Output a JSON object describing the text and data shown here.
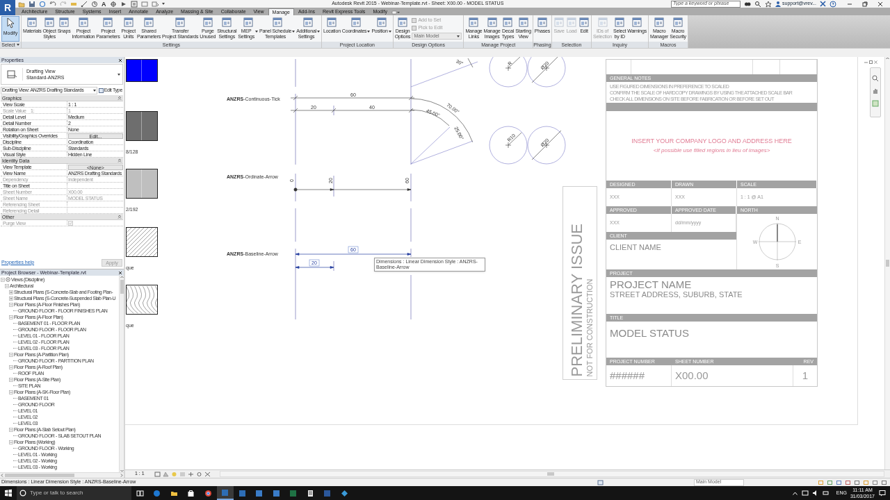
{
  "title_bar": {
    "app_button": "R",
    "text_tool": "A",
    "title": "Autodesk Revit 2015 -  Webinar-Template.rvt - Sheet: X00.00 - MODEL STATUS",
    "search_placeholder": "Type a keyword or phrase",
    "user": "support@vrev..."
  },
  "ribbon_tabs": [
    {
      "label": "Architecture",
      "selected": false
    },
    {
      "label": "Structure",
      "selected": false
    },
    {
      "label": "Systems",
      "selected": false
    },
    {
      "label": "Insert",
      "selected": false
    },
    {
      "label": "Annotate",
      "selected": false
    },
    {
      "label": "Analyze",
      "selected": false
    },
    {
      "label": "Massing & Site",
      "selected": false
    },
    {
      "label": "Collaborate",
      "selected": false
    },
    {
      "label": "View",
      "selected": false
    },
    {
      "label": "Manage",
      "selected": true
    },
    {
      "label": "Add-Ins",
      "selected": false
    },
    {
      "label": "Revit Express Tools",
      "selected": false
    },
    {
      "label": "Modify",
      "selected": false
    }
  ],
  "modify_tool": {
    "label": "Modify",
    "active": true,
    "panel_title": "Select"
  },
  "ribbon_panels": [
    {
      "title": "Settings",
      "tools": [
        {
          "label": "Materials"
        },
        {
          "label": "Object\nStyles"
        },
        {
          "label": "Snaps"
        },
        {
          "label": "Project\nInformation"
        },
        {
          "label": "Project\nParameters"
        },
        {
          "label": "Project\nUnits"
        },
        {
          "label": "Shared\nParameters"
        },
        {
          "label": "Transfer\nProject Standards"
        },
        {
          "label": "Purge\nUnused"
        },
        {
          "label": "Structural\nSettings"
        },
        {
          "label": "MEP\nSettings",
          "dropdown": true
        },
        {
          "label": "Panel Schedule\nTemplates",
          "dropdown": true
        },
        {
          "label": "Additional\nSettings",
          "dropdown": true
        }
      ]
    },
    {
      "title": "Project Location",
      "tools": [
        {
          "label": "Location"
        },
        {
          "label": "Coordinates",
          "dropdown": true
        },
        {
          "label": "Position",
          "dropdown": true
        }
      ]
    },
    {
      "title": "Design Options",
      "tools": [
        {
          "label": "Design\nOptions"
        }
      ],
      "small_tools": [
        {
          "label": "Add to Set",
          "disabled": true
        },
        {
          "label": "Pick to Edit",
          "disabled": true
        }
      ],
      "dropdown_value": "Main Model"
    },
    {
      "title": "Manage Project",
      "tools": [
        {
          "label": "Manage\nLinks"
        },
        {
          "label": "Manage\nImages"
        },
        {
          "label": "Decal\nTypes"
        },
        {
          "label": "Starting\nView"
        }
      ]
    },
    {
      "title": "Phasing",
      "tools": [
        {
          "label": "Phases"
        }
      ]
    },
    {
      "title": "Selection",
      "tools": [
        {
          "label": "Save",
          "disabled": true
        },
        {
          "label": "Load",
          "disabled": true
        },
        {
          "label": "Edit",
          "disabled": false
        }
      ]
    },
    {
      "title": "Inquiry",
      "tools": [
        {
          "label": "IDs of\nSelection",
          "disabled": true
        },
        {
          "label": "Select\nby ID",
          "disabled": false
        },
        {
          "label": "Warnings",
          "disabled": false
        }
      ]
    },
    {
      "title": "Macros",
      "tools": [
        {
          "label": "Macro\nManager"
        },
        {
          "label": "Macro\nSecurity"
        }
      ]
    }
  ],
  "properties": {
    "title": "Properties",
    "type_name": "Drafting View",
    "type_sub": "Standard-ANZRS",
    "instance_selector": "Drafting View: ANZRS Drafting Standards",
    "edit_type": "Edit Type",
    "groups": [
      {
        "title": "Graphics",
        "expanded": true,
        "rows": [
          {
            "name": "View Scale",
            "value": "1 : 1",
            "kind": "text",
            "disabled": false
          },
          {
            "name": "Scale Value    1:",
            "value": "1",
            "kind": "text",
            "disabled": true
          },
          {
            "name": "Detail Level",
            "value": "Medium",
            "kind": "text",
            "disabled": false
          },
          {
            "name": "Detail Number",
            "value": "2",
            "kind": "text",
            "disabled": false
          },
          {
            "name": "Rotation on Sheet",
            "value": "None",
            "kind": "text",
            "disabled": false
          },
          {
            "name": "Visibility/Graphics Overrides",
            "value": "Edit...",
            "kind": "button",
            "disabled": false
          },
          {
            "name": "Discipline",
            "value": "Coordination",
            "kind": "text",
            "disabled": false
          },
          {
            "name": "Sub-Discipline",
            "value": "Standards",
            "kind": "text",
            "disabled": false
          },
          {
            "name": "Visual Style",
            "value": "Hidden Line",
            "kind": "text",
            "disabled": false
          }
        ]
      },
      {
        "title": "Identity Data",
        "expanded": true,
        "rows": [
          {
            "name": "View Template",
            "value": "<None>",
            "kind": "button",
            "disabled": false
          },
          {
            "name": "View Name",
            "value": "ANZRS Drafting Standards",
            "kind": "text",
            "disabled": false
          },
          {
            "name": "Dependency",
            "value": "Independent",
            "kind": "text",
            "disabled": true
          },
          {
            "name": "Title on Sheet",
            "kind": "text",
            "disabled": false
          },
          {
            "name": "Sheet Number",
            "value": "X00.00",
            "kind": "text",
            "disabled": true
          },
          {
            "name": "Sheet Name",
            "value": "MODEL STATUS",
            "kind": "text",
            "disabled": true
          },
          {
            "name": "Referencing Sheet",
            "kind": "text",
            "disabled": true
          },
          {
            "name": "Referencing Detail",
            "kind": "text",
            "disabled": true
          }
        ]
      },
      {
        "title": "Other",
        "expanded": true,
        "rows": [
          {
            "name": "Purge View",
            "kind": "checkbox",
            "checked": true,
            "disabled": true
          }
        ]
      }
    ],
    "help_link": "Properties help",
    "apply": {
      "label": "Apply",
      "disabled": true
    }
  },
  "project_browser": {
    "title": "Project Browser - Webinar-Template.rvt",
    "tree": [
      {
        "label": "Views (Discipline)",
        "expanded": true,
        "children": [
          {
            "label": "Architectural",
            "expanded": true,
            "children": [
              {
                "label": "Structural Plans (S-Concrete-Slab and Footing Plan-",
                "expanded": false
              },
              {
                "label": "Structural Plans (S-Concrete-Suspended Slab Plan-U",
                "expanded": false
              },
              {
                "label": "Floor Plans (A-Floor Finishes Plan)",
                "expanded": true,
                "children": [
                  {
                    "label": "GROUND FLOOR - FLOOR FINISHES PLAN"
                  }
                ]
              },
              {
                "label": "Floor Plans (A-Floor Plan)",
                "expanded": true,
                "children": [
                  {
                    "label": "BASEMENT 01 - FLOOR PLAN"
                  },
                  {
                    "label": "GROUND FLOOR - FLOOR PLAN"
                  },
                  {
                    "label": "LEVEL 01 - FLOOR PLAN"
                  },
                  {
                    "label": "LEVEL 02 - FLOOR PLAN"
                  },
                  {
                    "label": "LEVEL 03 - FLOOR PLAN"
                  }
                ]
              },
              {
                "label": "Floor Plans (A-Partition Plan)",
                "expanded": true,
                "children": [
                  {
                    "label": "GROUND FLOOR - PARTITION PLAN"
                  }
                ]
              },
              {
                "label": "Floor Plans (A-Roof Plan)",
                "expanded": true,
                "children": [
                  {
                    "label": "ROOF PLAN"
                  }
                ]
              },
              {
                "label": "Floor Plans (A-Site Plan)",
                "expanded": true,
                "children": [
                  {
                    "label": "SITE PLAN"
                  }
                ]
              },
              {
                "label": "Floor Plans (A-SK-Floor Plan)",
                "expanded": true,
                "children": [
                  {
                    "label": "BASEMENT 01"
                  },
                  {
                    "label": "GROUND FLOOR"
                  },
                  {
                    "label": "LEVEL 01"
                  },
                  {
                    "label": "LEVEL 02"
                  },
                  {
                    "label": "LEVEL 03"
                  }
                ]
              },
              {
                "label": "Floor Plans (A-Slab Setout Plan)",
                "expanded": true,
                "children": [
                  {
                    "label": "GROUND FLOOR - SLAB SETOUT PLAN"
                  }
                ]
              },
              {
                "label": "Floor Plans (Working)",
                "expanded": true,
                "children": [
                  {
                    "label": "GROUND FLOOR - Working"
                  },
                  {
                    "label": "LEVEL 01 - Working"
                  },
                  {
                    "label": "LEVEL 02 - Working"
                  },
                  {
                    "label": "LEVEL 03 - Working"
                  }
                ]
              }
            ]
          }
        ]
      }
    ]
  },
  "drawing": {
    "legend_swatches": [
      {
        "kind": "solid",
        "color": "#0000ff"
      },
      {
        "kind": "solid",
        "color": "#6e6e6e",
        "caption": "8/128"
      },
      {
        "kind": "solid",
        "color": "#bfbfbf",
        "caption": "2/192"
      },
      {
        "kind": "hatch",
        "caption": "que"
      },
      {
        "kind": "wood",
        "caption": "que"
      }
    ],
    "dimension_styles": [
      {
        "kind": "continuous",
        "label": "**ANZRS**-Continuous-Tick",
        "values": [
          "60",
          "20",
          "40"
        ],
        "selected": false
      },
      {
        "kind": "ordinate",
        "label": "**ANZRS**-Ordinate-Arrow",
        "values": [
          "0",
          "20",
          "60"
        ],
        "selected": false
      },
      {
        "kind": "baseline",
        "label": "**ANZRS**-Baseline-Arrow",
        "values": [
          "60",
          "20"
        ],
        "selected": true
      }
    ],
    "angular_dims": [
      "30°",
      "70.00°",
      "45.00°",
      "25.00°"
    ],
    "radial_dims": [
      "R",
      "Ø20",
      "R10",
      "Ø20"
    ],
    "tooltip": "Dimensions : Linear Dimension Style : ANZRS-Baseline-Arrow"
  },
  "title_block": {
    "preliminary": "PRELIMINARY ISSUE",
    "preliminary_sub": "NOT FOR CONSTRUCTION",
    "general_notes": "GENERAL NOTES",
    "notes": [
      "USE FIGURED DIMENSIONS IN PREFERENCE TO SCALED",
      "CONFIRM THE SCALE OF HARDCOPY DRAWINGS BY USING THE ATTACHED SCALE BAR",
      "CHECK ALL DIMENSIONS ON SITE BEFORE FABRICATION OR BEFORE SET OUT"
    ],
    "logo_text": "INSERT YOUR COMPANY LOGO AND ADDRESS HERE",
    "logo_hint": "<If possible use filled regions in lieu of images>",
    "designed": {
      "label": "DESIGNED",
      "value": "XXX"
    },
    "drawn": {
      "label": "DRAWN",
      "value": "XXX"
    },
    "scale": {
      "label": "SCALE",
      "value": "1 : 1 @ A1"
    },
    "approved": {
      "label": "APPROVED",
      "value": "XXX"
    },
    "approved_date": {
      "label": "APPROVED DATE",
      "value": "dd/mm/yyyy"
    },
    "north": {
      "label": "NORTH",
      "n": "N",
      "e": "E",
      "s": "S",
      "w": "W"
    },
    "client": {
      "label": "CLIENT",
      "value": "CLIENT NAME"
    },
    "project": {
      "label": "PROJECT",
      "name": "PROJECT NAME",
      "address": "STREET ADDRESS, SUBURB, STATE"
    },
    "title": {
      "label": "TITLE",
      "value": "MODEL STATUS"
    },
    "project_number": {
      "label": "PROJECT NUMBER",
      "value": "######"
    },
    "sheet_number": {
      "label": "SHEET NUMBER",
      "value": "X00.00"
    },
    "rev": {
      "label": "REV",
      "value": "1"
    }
  },
  "view_control_bar": {
    "scale": "1 : 1"
  },
  "status_bar": {
    "message": "Dimensions : Linear Dimension Style : ANZRS-Baseline-Arrow",
    "design_option": "Main Model"
  },
  "taskbar": {
    "search_placeholder": "Type or talk to search",
    "language": "ENG",
    "time": "11:11 AM",
    "date": "31/03/2017"
  }
}
